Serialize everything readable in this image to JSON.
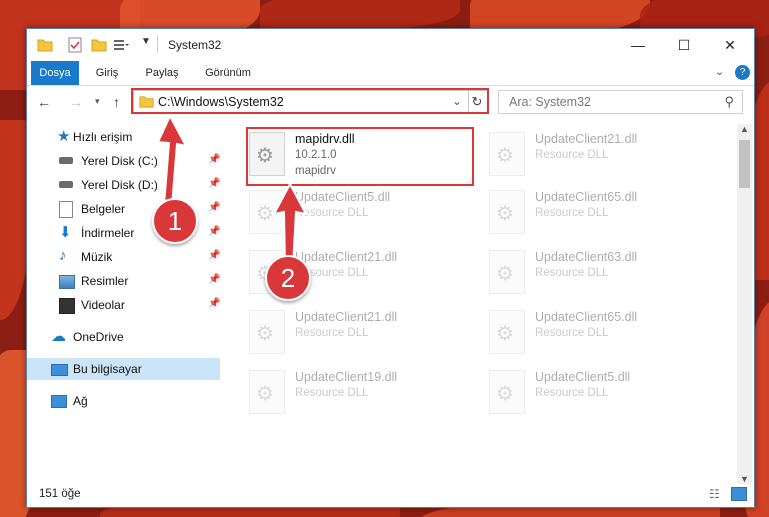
{
  "window": {
    "title": "System32"
  },
  "ribbon": {
    "tabs": [
      "Dosya",
      "Giriş",
      "Paylaş",
      "Görünüm"
    ]
  },
  "address": {
    "path": "C:\\Windows\\System32",
    "search_placeholder": "Ara: System32"
  },
  "sidebar": {
    "items": [
      {
        "label": "Hızlı erişim"
      },
      {
        "label": "Yerel Disk (C:)"
      },
      {
        "label": "Yerel Disk (D:)"
      },
      {
        "label": "Belgeler"
      },
      {
        "label": "İndirmeler"
      },
      {
        "label": "Müzik"
      },
      {
        "label": "Resimler"
      },
      {
        "label": "Videolar"
      },
      {
        "label": "OneDrive"
      },
      {
        "label": "Bu bilgisayar"
      },
      {
        "label": "Ağ"
      }
    ]
  },
  "files": [
    {
      "name": "mapidrv.dll",
      "line2": "10.2.1.0",
      "line3": "mapidrv"
    },
    {
      "name": "UpdateClient21.dll",
      "line2": "Resource DLL"
    },
    {
      "name": "UpdateClient5.dll",
      "line2": "Resource DLL"
    },
    {
      "name": "UpdateClient65.dll",
      "line2": "Resource DLL"
    },
    {
      "name": "UpdateClient21.dll",
      "line2": "Resource DLL"
    },
    {
      "name": "UpdateClient63.dll",
      "line2": "Resource DLL"
    },
    {
      "name": "UpdateClient21.dll",
      "line2": "Resource DLL"
    },
    {
      "name": "UpdateClient65.dll",
      "line2": "Resource DLL"
    },
    {
      "name": "UpdateClient19.dll",
      "line2": "Resource DLL"
    },
    {
      "name": "UpdateClient5.dll",
      "line2": "Resource DLL"
    }
  ],
  "status": {
    "count": "151 öğe"
  },
  "annotations": {
    "step1": "1",
    "step2": "2",
    "color": "#d9373a"
  }
}
